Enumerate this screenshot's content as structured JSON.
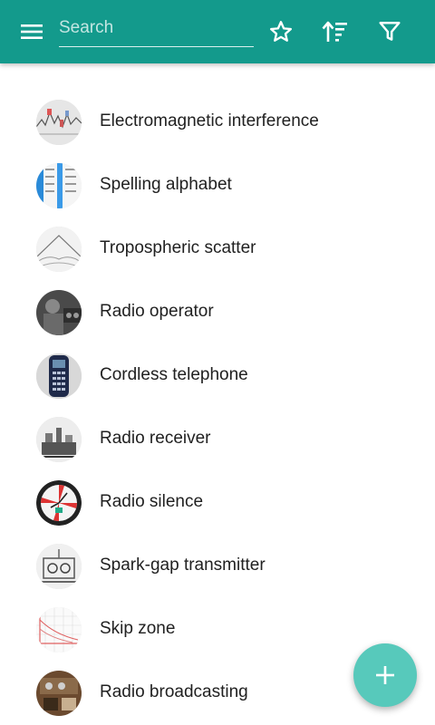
{
  "toolbar": {
    "search": {
      "placeholder": "Search",
      "value": ""
    },
    "icons": {
      "menu": "menu-icon",
      "favorites": "star-outline-icon",
      "sort": "sort-icon",
      "filter": "filter-icon"
    },
    "background_color": "#139a8c"
  },
  "items": [
    {
      "label": "Electromagnetic interference"
    },
    {
      "label": "Spelling alphabet"
    },
    {
      "label": "Tropospheric scatter"
    },
    {
      "label": "Radio operator"
    },
    {
      "label": "Cordless telephone"
    },
    {
      "label": "Radio receiver"
    },
    {
      "label": "Radio silence"
    },
    {
      "label": "Spark-gap transmitter"
    },
    {
      "label": "Skip zone"
    },
    {
      "label": "Radio broadcasting"
    }
  ],
  "fab": {
    "icon": "plus-icon",
    "color": "#57c9bb"
  }
}
